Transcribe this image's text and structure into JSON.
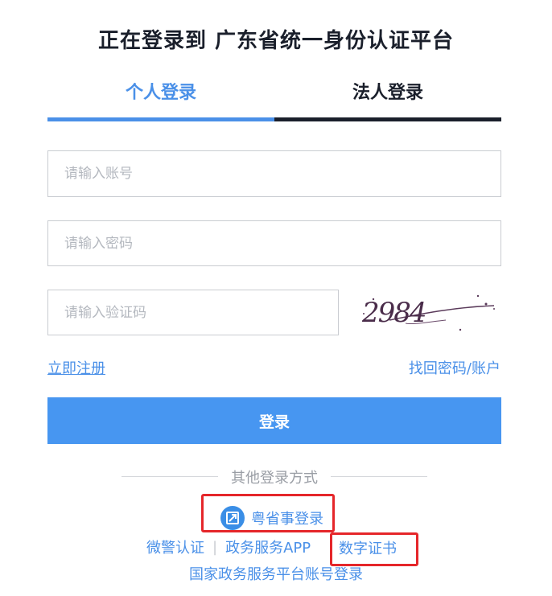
{
  "header": {
    "title": "正在登录到 广东省统一身份认证平台"
  },
  "tabs": [
    {
      "label": "个人登录",
      "active": true
    },
    {
      "label": "法人登录",
      "active": false
    }
  ],
  "form": {
    "account_placeholder": "请输入账号",
    "password_placeholder": "请输入密码",
    "captcha_placeholder": "请输入验证码",
    "captcha_text": "2984"
  },
  "links": {
    "register": "立即注册",
    "recover": "找回密码/账户"
  },
  "login_button": "登录",
  "other_methods": {
    "divider_label": "其他登录方式",
    "yss_login": "粤省事登录",
    "wechat_police": "微警认证",
    "separator": "|",
    "gov_app": "政务服务APP",
    "digital_cert": "数字证书",
    "national_platform": "国家政务服务平台账号登录"
  },
  "colors": {
    "accent": "#4a90e8",
    "button": "#4796f1",
    "highlight_box": "#e5262a",
    "dark": "#1a1f2b"
  }
}
